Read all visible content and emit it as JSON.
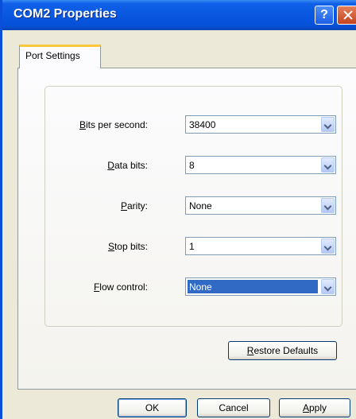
{
  "window": {
    "title": "COM2 Properties"
  },
  "titlebar_buttons": {
    "help": "?",
    "close_icon": "close-icon"
  },
  "tabs": [
    {
      "label": "Port Settings"
    }
  ],
  "fields": [
    {
      "label_ul": "B",
      "label_rest": "its per second:",
      "value": "38400",
      "selected": false
    },
    {
      "label_ul": "D",
      "label_rest": "ata bits:",
      "value": "8",
      "selected": false
    },
    {
      "label_ul": "P",
      "label_rest": "arity:",
      "value": "None",
      "selected": false
    },
    {
      "label_ul": "S",
      "label_rest": "top bits:",
      "value": "1",
      "selected": false
    },
    {
      "label_ul": "F",
      "label_rest": "low control:",
      "value": "None",
      "selected": true
    }
  ],
  "buttons": {
    "restore_ul": "R",
    "restore_rest": "estore Defaults",
    "ok": "OK",
    "cancel": "Cancel",
    "apply_ul": "A",
    "apply_rest": "pply"
  },
  "colors": {
    "titlebar": "#0a58e0",
    "tab_highlight": "#ffc83c",
    "selection": "#316ac5",
    "dialog_bg": "#ece9d8"
  }
}
